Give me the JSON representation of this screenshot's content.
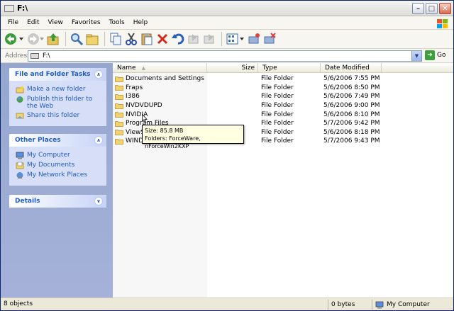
{
  "window": {
    "title": "F:\\"
  },
  "menu": [
    "File",
    "Edit",
    "View",
    "Favorites",
    "Tools",
    "Help"
  ],
  "toolbar": {
    "back_icon": "back-arrow-icon",
    "forward_icon": "forward-arrow-icon",
    "up_icon": "up-folder-icon",
    "search_icon": "search-icon",
    "folders_icon": "folders-icon",
    "copy_icon": "copy-icon",
    "cut_icon": "cut-icon",
    "paste_icon": "paste-icon",
    "delete_icon": "delete-icon",
    "undo_icon": "undo-icon",
    "views_icon": "views-icon"
  },
  "address": {
    "label": "Address",
    "value": "F:\\",
    "go_label": "Go"
  },
  "left_pane": {
    "file_tasks": {
      "title": "File and Folder Tasks",
      "items": [
        "Make a new folder",
        "Publish this folder to the Web",
        "Share this folder"
      ]
    },
    "other_places": {
      "title": "Other Places",
      "items": [
        "My Computer",
        "My Documents",
        "My Network Places"
      ]
    },
    "details": {
      "title": "Details"
    }
  },
  "columns": {
    "name": "Name",
    "size": "Size",
    "type": "Type",
    "date": "Date Modified"
  },
  "files": [
    {
      "name": "Documents and Settings",
      "type": "File Folder",
      "date": "5/6/2006 7:55 PM"
    },
    {
      "name": "Fraps",
      "type": "File Folder",
      "date": "5/6/2006 8:50 PM"
    },
    {
      "name": "I386",
      "type": "File Folder",
      "date": "5/6/2006 7:49 PM"
    },
    {
      "name": "NVDVDUPD",
      "type": "File Folder",
      "date": "5/6/2006 9:00 PM"
    },
    {
      "name": "NVIDIA",
      "type": "File Folder",
      "date": "5/6/2006 8:10 PM"
    },
    {
      "name": "Program Files",
      "type": "File Folder",
      "date": "5/7/2006 9:42 PM"
    },
    {
      "name": "ViewSo",
      "type": "File Folder",
      "date": "5/6/2006 8:18 PM"
    },
    {
      "name": "WINDO",
      "type": "File Folder",
      "date": "5/7/2006 9:43 PM"
    }
  ],
  "tooltip": {
    "line1": "Size: 85.8 MB",
    "line2": "Folders: ForceWare, nForceWin2KXP"
  },
  "status": {
    "objects": "8 objects",
    "size": "0 bytes",
    "location": "My Computer"
  }
}
